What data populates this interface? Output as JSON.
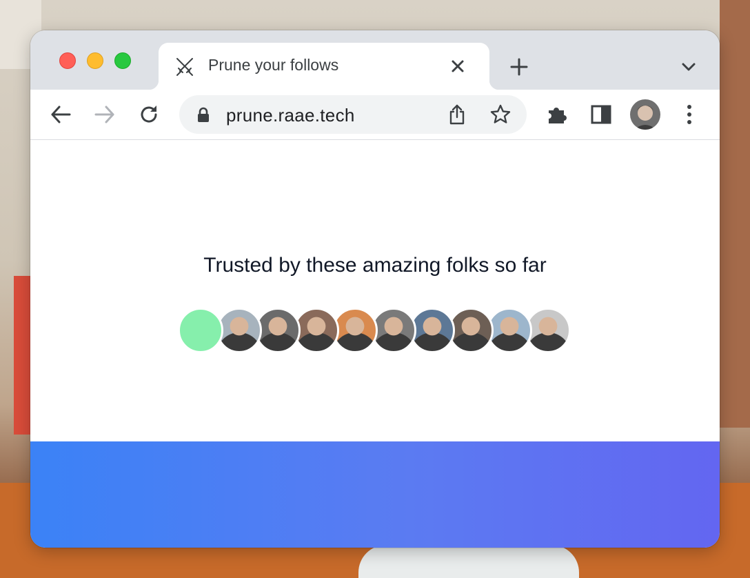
{
  "tab": {
    "title": "Prune your follows",
    "favicon": "crossed-swords-icon"
  },
  "toolbar": {
    "url": "prune.raae.tech"
  },
  "page": {
    "headline": "Trusted by these amazing folks so far",
    "avatars": [
      {
        "name": "avatar-1",
        "color": "#86efac"
      },
      {
        "name": "avatar-2",
        "color": "#a7b3bd"
      },
      {
        "name": "avatar-3",
        "color": "#6b6b6b"
      },
      {
        "name": "avatar-4",
        "color": "#8a6a5a"
      },
      {
        "name": "avatar-5",
        "color": "#d98a4f"
      },
      {
        "name": "avatar-6",
        "color": "#7a7a7a"
      },
      {
        "name": "avatar-7",
        "color": "#5d7896"
      },
      {
        "name": "avatar-8",
        "color": "#6d5f55"
      },
      {
        "name": "avatar-9",
        "color": "#9db6cc"
      },
      {
        "name": "avatar-10",
        "color": "#c8c8c8"
      }
    ]
  },
  "colors": {
    "accent_gradient_start": "#3b82f6",
    "accent_gradient_end": "#6366f1"
  }
}
